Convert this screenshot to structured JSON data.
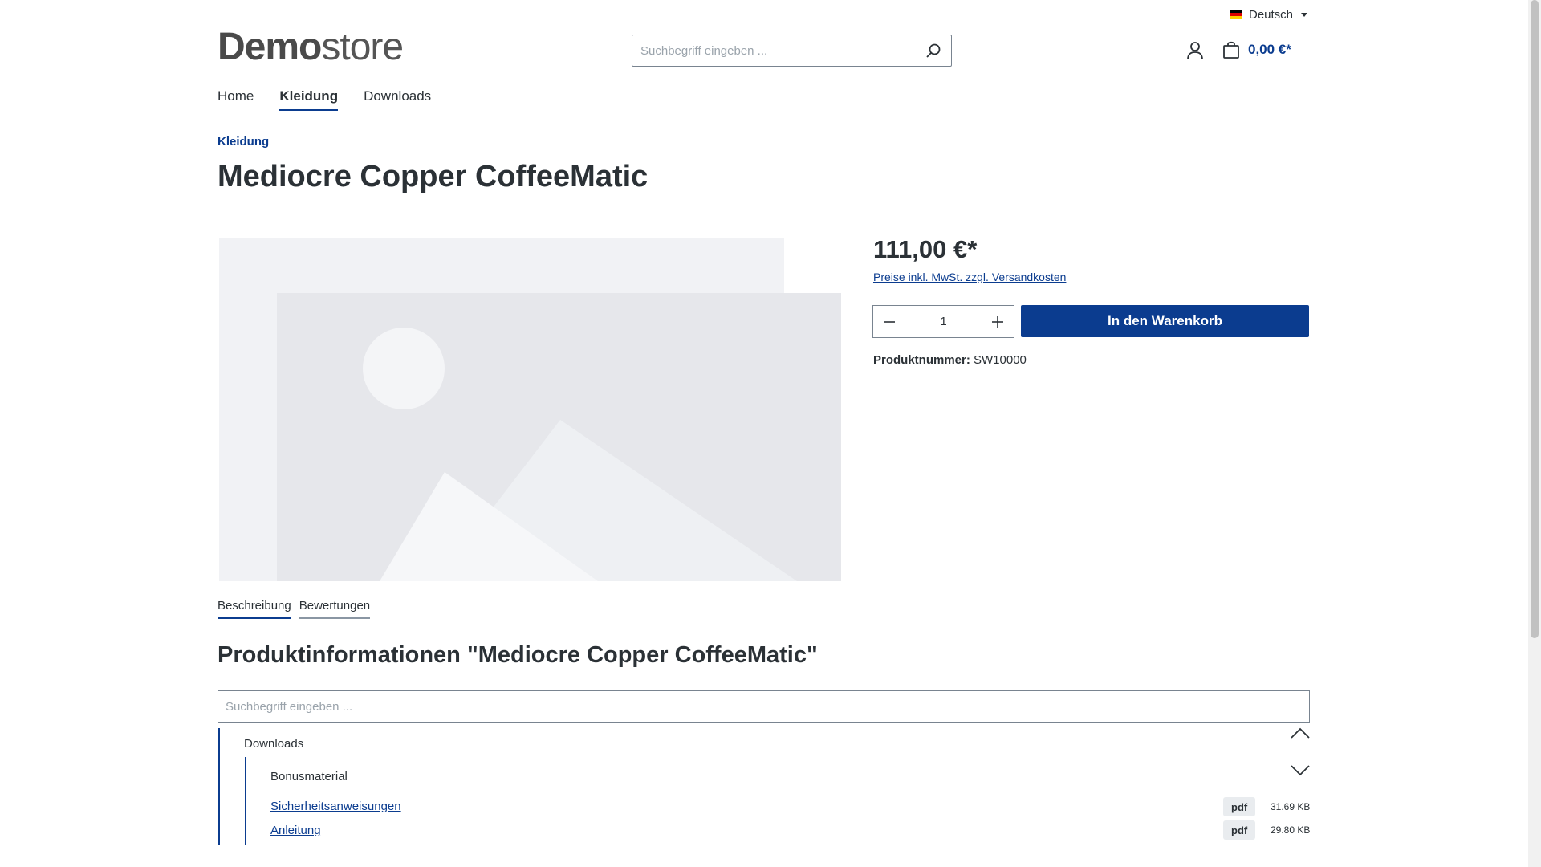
{
  "header": {
    "language": "Deutsch",
    "logo_bold": "Demo",
    "logo_light": "store",
    "search_placeholder": "Suchbegriff eingeben ...",
    "cart_total": "0,00 €*"
  },
  "nav": {
    "items": [
      {
        "label": "Home"
      },
      {
        "label": "Kleidung",
        "active": true
      },
      {
        "label": "Downloads"
      }
    ]
  },
  "breadcrumb": "Kleidung",
  "product": {
    "title": "Mediocre Copper CoffeeMatic",
    "price": "111,00 €*",
    "vat_note": "Preise inkl. MwSt. zzgl. Versandkosten",
    "quantity": "1",
    "add_to_cart": "In den Warenkorb",
    "product_number_label": "Produktnummer:",
    "product_number": "SW10000"
  },
  "tabs": [
    "Beschreibung",
    "Bewertungen"
  ],
  "info": {
    "heading": "Produktinformationen \"Mediocre Copper CoffeeMatic\"",
    "filter_placeholder": "Suchbegriff eingeben ...",
    "folder": "Downloads",
    "subfolder": "Bonusmaterial",
    "files": [
      {
        "name": "Sicherheitsanweisungen",
        "type": "pdf",
        "size": "31.69 KB"
      },
      {
        "name": "Anleitung",
        "type": "pdf",
        "size": "29.80 KB"
      }
    ]
  },
  "colors": {
    "accent": "#0b3c8f",
    "text": "#2b3136",
    "placeholder_bg": "#e9eaee"
  }
}
